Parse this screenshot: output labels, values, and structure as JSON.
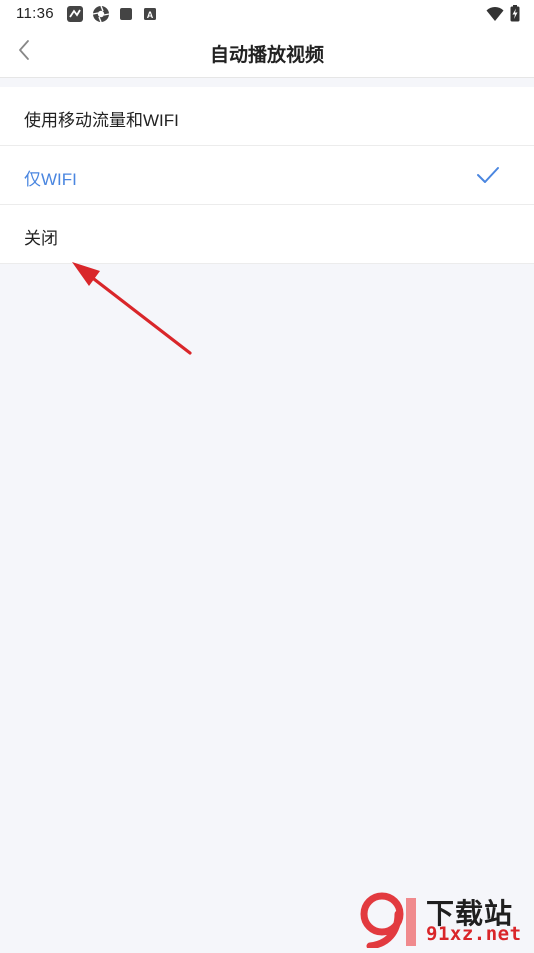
{
  "status_bar": {
    "time": "11:36",
    "left_icons": [
      "app-notification-icon",
      "aperture-icon",
      "square-icon",
      "letter-a-icon"
    ],
    "right_icons": [
      "wifi-icon",
      "battery-charging-icon"
    ],
    "a_badge": "A"
  },
  "header": {
    "title": "自动播放视频",
    "back_icon": "chevron-left-icon"
  },
  "options": [
    {
      "label": "使用移动流量和WIFI",
      "selected": false
    },
    {
      "label": "仅WIFI",
      "selected": true
    },
    {
      "label": "关闭",
      "selected": false
    }
  ],
  "colors": {
    "accent": "#4a86e0",
    "background": "#f5f6fa",
    "annotation_arrow": "#d9262a"
  },
  "watermark": {
    "title": "下载站",
    "domain": "91xz.net",
    "logo_text": "9"
  }
}
